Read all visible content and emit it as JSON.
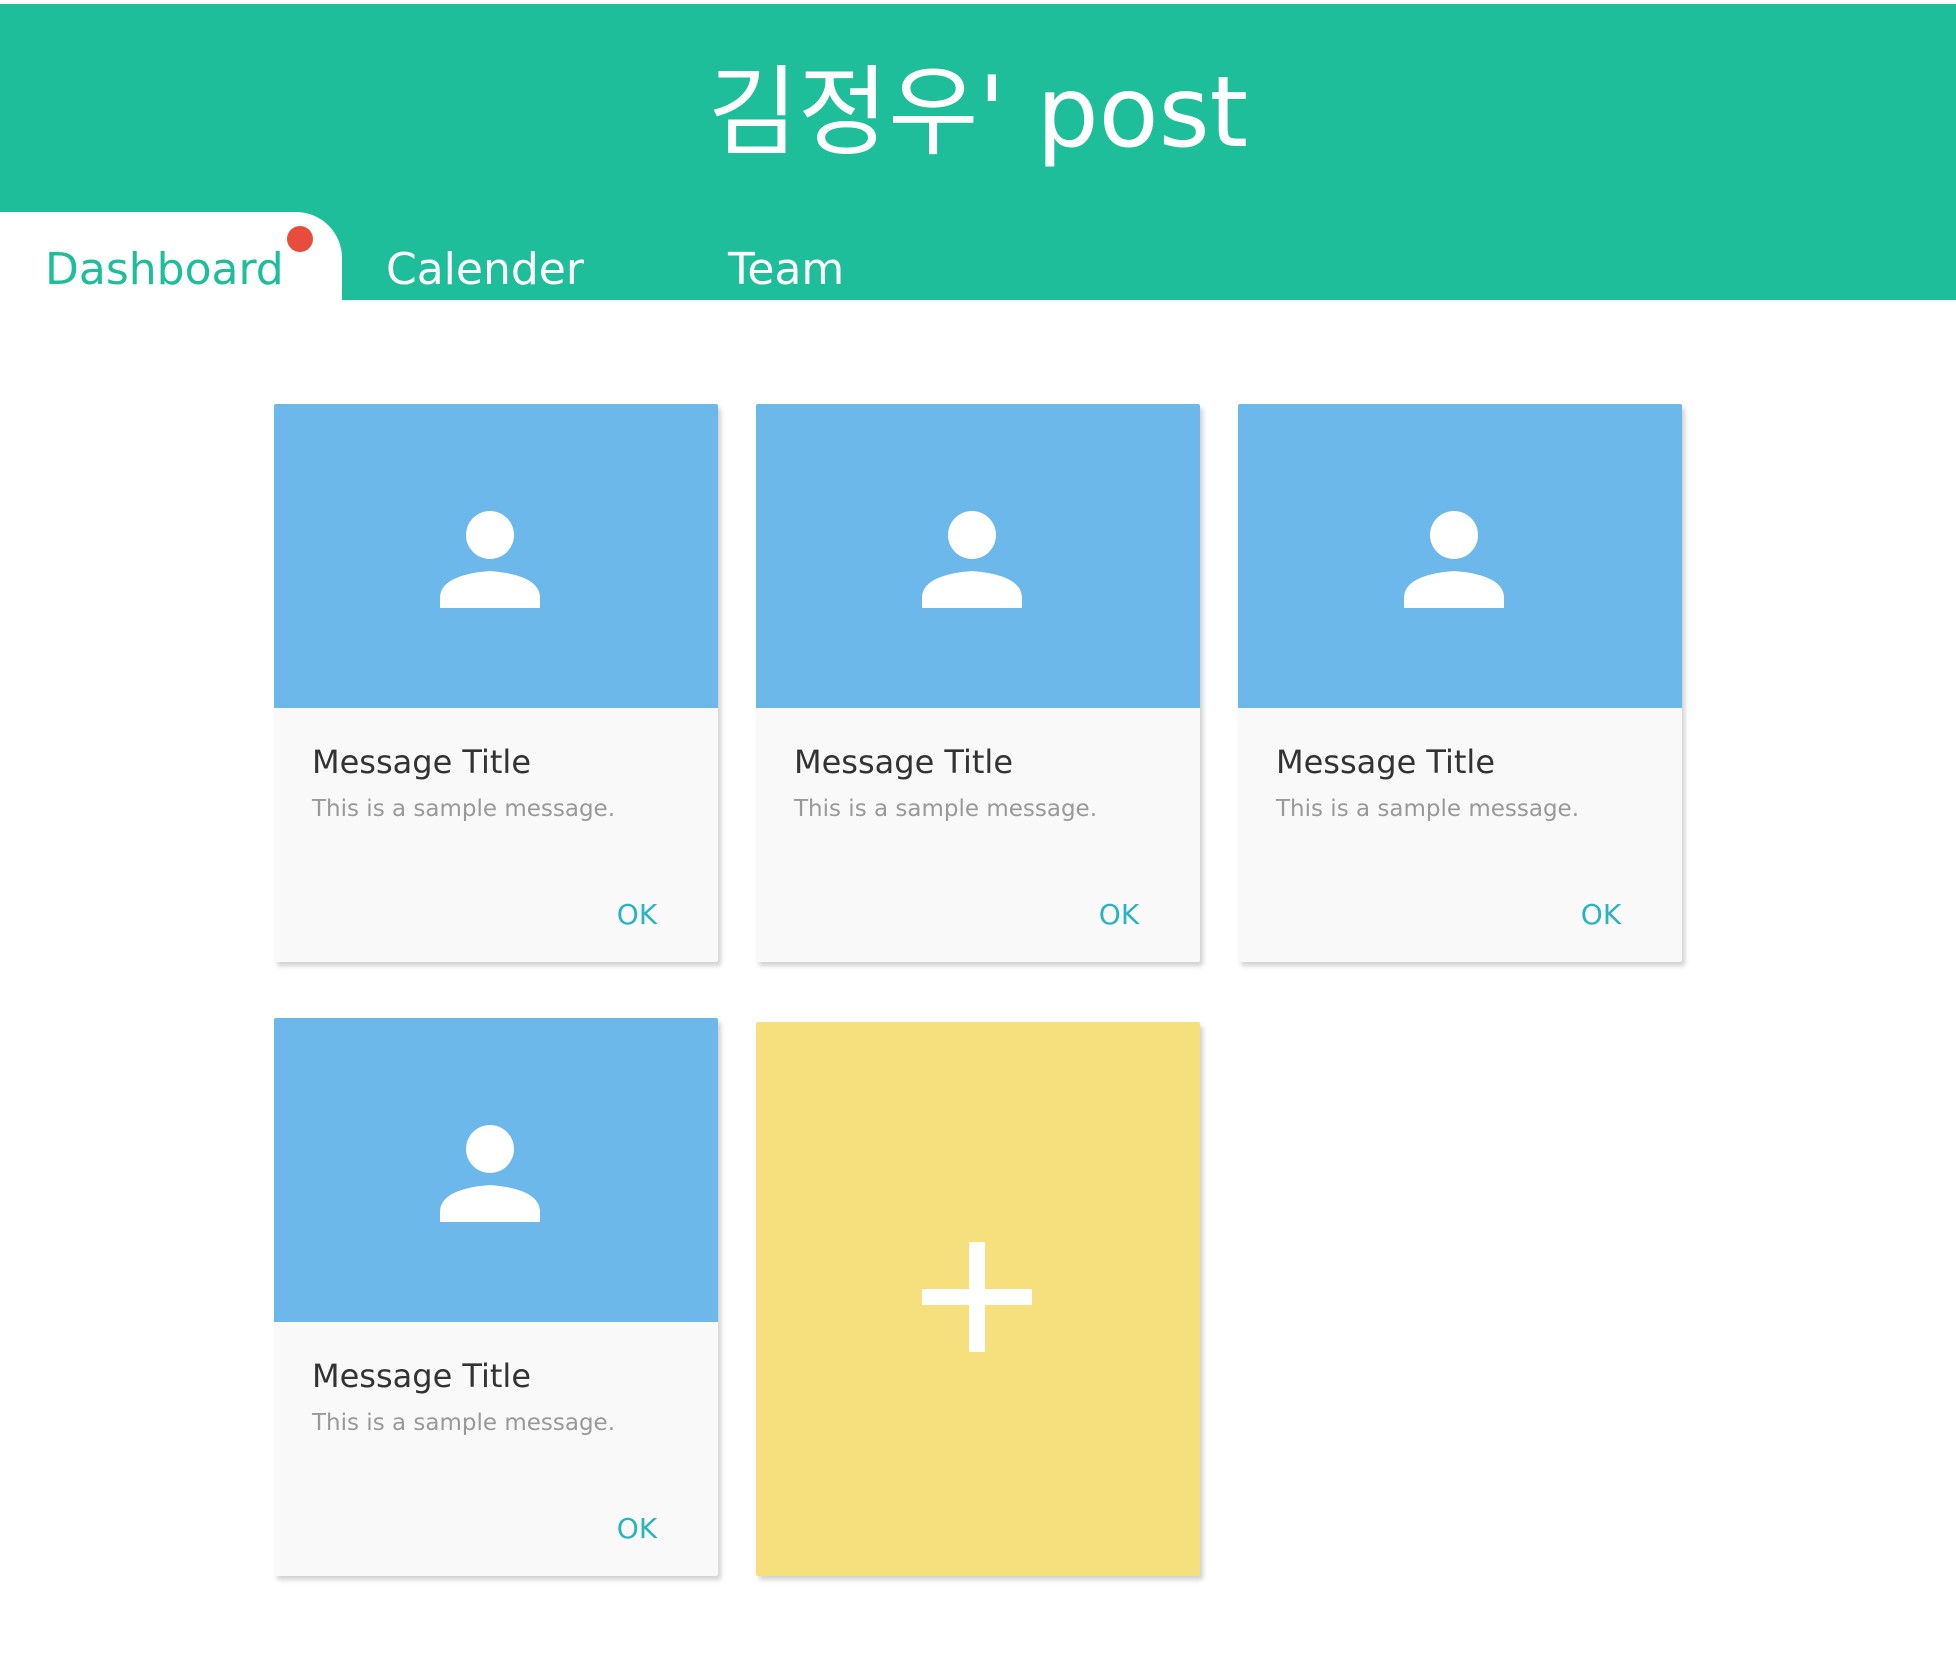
{
  "header": {
    "title": "김정우' post"
  },
  "tabs": [
    {
      "label": "Dashboard",
      "active": true,
      "notification": true
    },
    {
      "label": "Calender",
      "active": false
    },
    {
      "label": "Team",
      "active": false
    }
  ],
  "cards": [
    {
      "icon": "person-icon",
      "title": "Message Title",
      "text": "This is a sample message.",
      "action": "OK"
    },
    {
      "icon": "person-icon",
      "title": "Message Title",
      "text": "This is a sample message.",
      "action": "OK"
    },
    {
      "icon": "person-icon",
      "title": "Message Title",
      "text": "This is a sample message.",
      "action": "OK"
    },
    {
      "icon": "person-icon",
      "title": "Message Title",
      "text": "This is a sample message.",
      "action": "OK"
    }
  ],
  "add_card": {
    "icon": "plus-icon"
  },
  "colors": {
    "header": "#1ebe9b",
    "card_media": "#6db8eb",
    "add_card": "#f6df7d",
    "action": "#2bb3bf",
    "notification_dot": "#e74c3c"
  }
}
